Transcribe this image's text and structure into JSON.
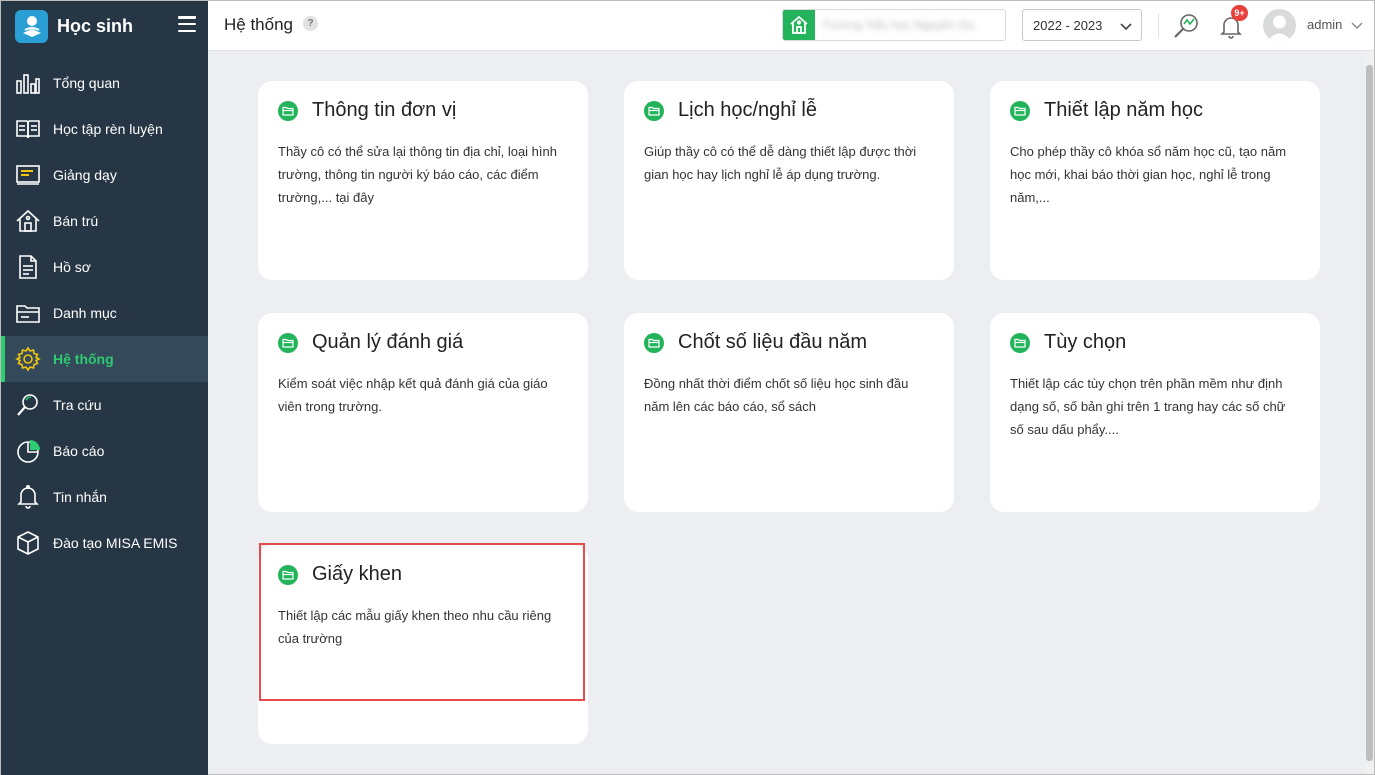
{
  "app": {
    "title": "Học sinh"
  },
  "sidebar": {
    "items": [
      {
        "label": "Tổng quan",
        "icon": "bar-chart-icon",
        "active": false
      },
      {
        "label": "Học tập rèn luyện",
        "icon": "book-open-icon",
        "active": false
      },
      {
        "label": "Giảng dạy",
        "icon": "board-icon",
        "active": false
      },
      {
        "label": "Bán trú",
        "icon": "house-icon",
        "active": false
      },
      {
        "label": "Hồ sơ",
        "icon": "document-icon",
        "active": false
      },
      {
        "label": "Danh mục",
        "icon": "folder-icon",
        "active": false
      },
      {
        "label": "Hệ thống",
        "icon": "gear-icon",
        "active": true
      },
      {
        "label": "Tra cứu",
        "icon": "search-icon",
        "active": false
      },
      {
        "label": "Báo cáo",
        "icon": "pie-chart-icon",
        "active": false
      },
      {
        "label": "Tin nhắn",
        "icon": "bell-icon",
        "active": false
      },
      {
        "label": "Đào tạo MISA EMIS",
        "icon": "cube-icon",
        "active": false
      }
    ]
  },
  "header": {
    "page_title": "Hệ thống",
    "help": "?",
    "school_name": "Trường Tiểu học Nguyễn Du",
    "year": "2022 - 2023",
    "notification_badge": "9+",
    "user": "admin"
  },
  "cards": [
    {
      "title": "Thông tin đơn vị",
      "desc": "Thầy cô có thể sửa lại thông tin địa chỉ, loại hình trường, thông tin người ký báo cáo, các điểm trường,... tại đây"
    },
    {
      "title": "Lịch học/nghỉ lễ",
      "desc": "Giúp thầy cô có thể dễ dàng thiết lập được thời gian học hay lịch nghỉ lễ áp dụng trường."
    },
    {
      "title": "Thiết lập năm học",
      "desc": "Cho phép thầy cô khóa sổ năm học cũ, tạo năm học mới, khai báo thời gian học, nghỉ lễ trong năm,..."
    },
    {
      "title": "Quản lý đánh giá",
      "desc": "Kiểm soát việc nhập kết quả đánh giá của giáo viên trong trường."
    },
    {
      "title": "Chốt số liệu đầu năm",
      "desc": "Đồng nhất thời điểm chốt số liệu học sinh đầu năm lên các báo cáo, sổ sách"
    },
    {
      "title": "Tùy chọn",
      "desc": "Thiết lập các tùy chọn trên phần mềm như định dạng số, số bản ghi trên 1 trang hay các số chữ số sau dấu phẩy...."
    },
    {
      "title": "Giấy khen",
      "desc": "Thiết lập các mẫu giấy khen theo nhu cầu riêng của trường"
    }
  ],
  "colors": {
    "sidebar_bg": "#263645",
    "accent_green": "#22b35b",
    "active_green": "#2ecc71",
    "highlight_red": "#e74c4c"
  }
}
